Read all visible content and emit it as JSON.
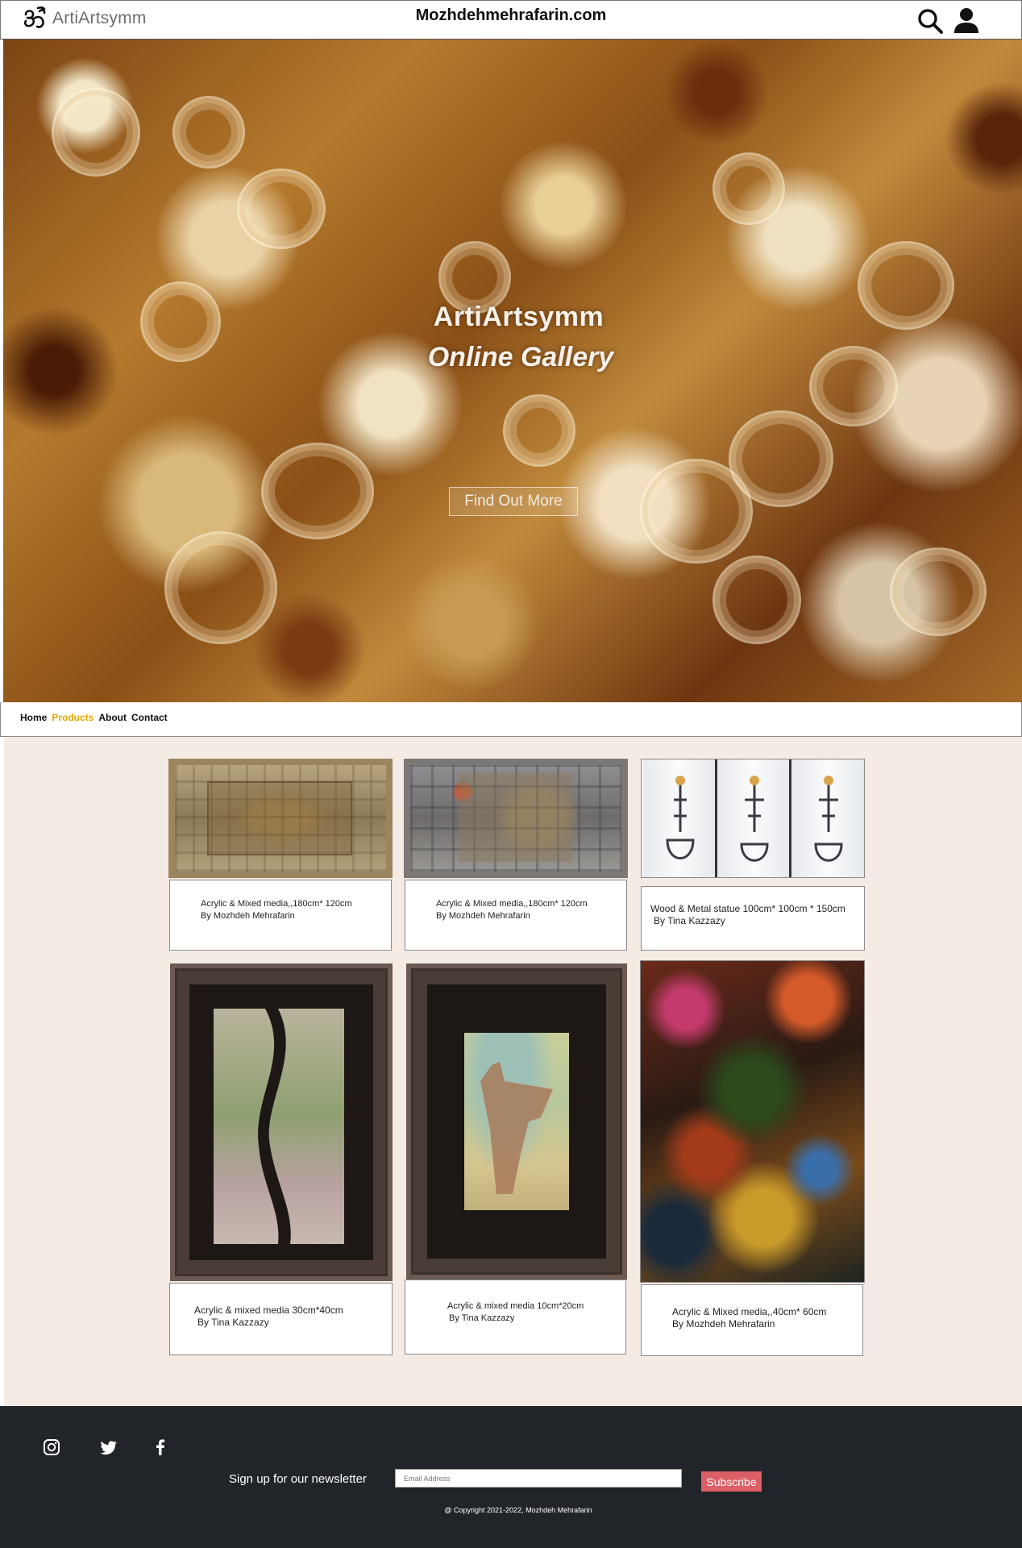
{
  "header": {
    "logo_text": "ArtiArtsymm",
    "site_title": "Mozhdehmehrafarin.com",
    "icons": [
      "om-logo-icon",
      "search-icon",
      "user-icon"
    ]
  },
  "hero": {
    "title": "ArtiArtsymm",
    "subtitle": "Online Gallery",
    "button_label": "Find Out More"
  },
  "nav": {
    "links": [
      {
        "label": "Home",
        "active": false
      },
      {
        "label": "Products",
        "active": true
      },
      {
        "label": "About",
        "active": false
      },
      {
        "label": "Contact",
        "active": false
      }
    ],
    "active_color": "#e0a800"
  },
  "products": [
    {
      "title": "Acrylic & Mixed media,,180cm* 120cm",
      "artist": "By Mozhdeh Mehrafarin"
    },
    {
      "title": "Acrylic & Mixed media,,180cm* 120cm",
      "artist": "By Mozhdeh Mehrafarin"
    },
    {
      "title": "Wood & Metal statue 100cm* 100cm * 150cm",
      "artist": "By Tina Kazzazy"
    },
    {
      "title": "Acrylic & mixed media 30cm*40cm",
      "artist": "By Tina Kazzazy"
    },
    {
      "title": "Acrylic & mixed media 10cm*20cm",
      "artist": "By Tina Kazzazy"
    },
    {
      "title": "Acrylic & Mixed media,,40cm* 60cm",
      "artist": "By Mozhdeh Mehrafarin"
    }
  ],
  "footer": {
    "social_icons": [
      "instagram-icon",
      "twitter-icon",
      "facebook-icon"
    ],
    "newsletter_label": "Sign up for our newsletter",
    "email_placeholder": "Email Address",
    "subscribe_label": "Subscribe",
    "copyright": "@ Copyright 2021-2022, Mozhdeh Mehrafarin",
    "background": "#212529",
    "subscribe_color": "#dc5f66"
  }
}
